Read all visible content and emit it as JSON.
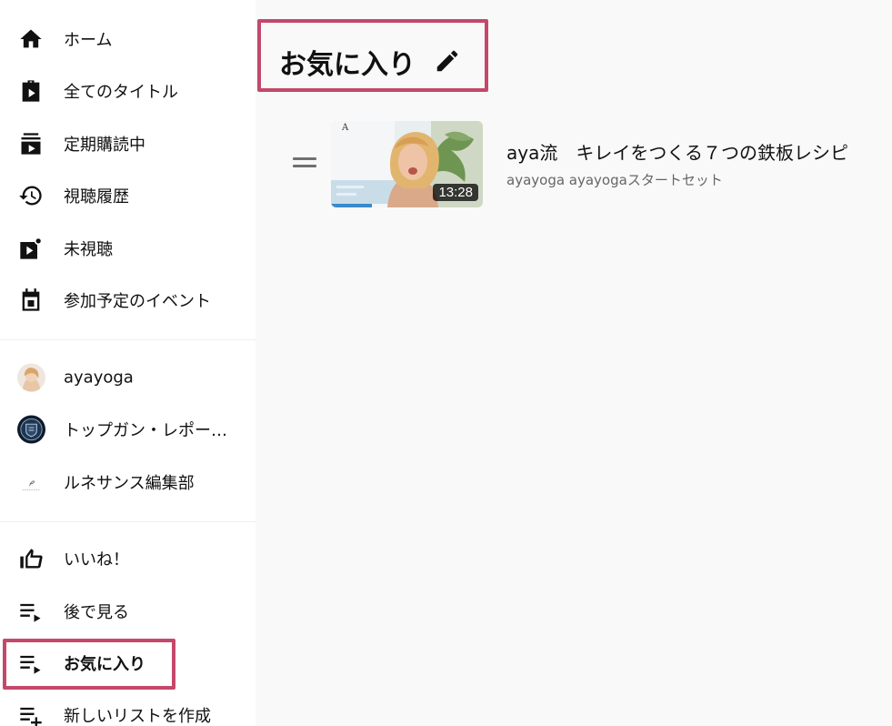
{
  "sidebar": {
    "main_items": [
      {
        "label": "ホーム",
        "icon": "home-icon"
      },
      {
        "label": "全てのタイトル",
        "icon": "all-titles-icon"
      },
      {
        "label": "定期購読中",
        "icon": "subscriptions-icon"
      },
      {
        "label": "視聴履歴",
        "icon": "history-icon"
      },
      {
        "label": "未視聴",
        "icon": "unwatched-icon"
      },
      {
        "label": "参加予定のイベント",
        "icon": "calendar-icon"
      }
    ],
    "channels": [
      {
        "label": "ayayoga",
        "icon": "avatar-ayayoga"
      },
      {
        "label": "トップガン・レポー…",
        "icon": "avatar-topgun"
      },
      {
        "label": "ルネサンス編集部",
        "icon": "avatar-renaissance"
      }
    ],
    "library_items": [
      {
        "label": "いいね！",
        "icon": "thumbs-up-icon"
      },
      {
        "label": "後で見る",
        "icon": "playlist-icon"
      },
      {
        "label": "お気に入り",
        "icon": "playlist-icon",
        "active": true
      },
      {
        "label": "新しいリストを作成",
        "icon": "playlist-add-icon"
      }
    ]
  },
  "main": {
    "title": "お気に入り",
    "videos": [
      {
        "title": "aya流　キレイをつくる７つの鉄板レシピ",
        "meta": "ayayoga ayayogaスタートセット",
        "duration": "13:28",
        "thumb_logo": "A",
        "watched_fraction": 0.27
      }
    ]
  },
  "colors": {
    "highlight": "#c4486a",
    "sidebar_bg": "#ffffff",
    "main_bg": "#f9f9f9",
    "progress": "#3a8ac9"
  }
}
